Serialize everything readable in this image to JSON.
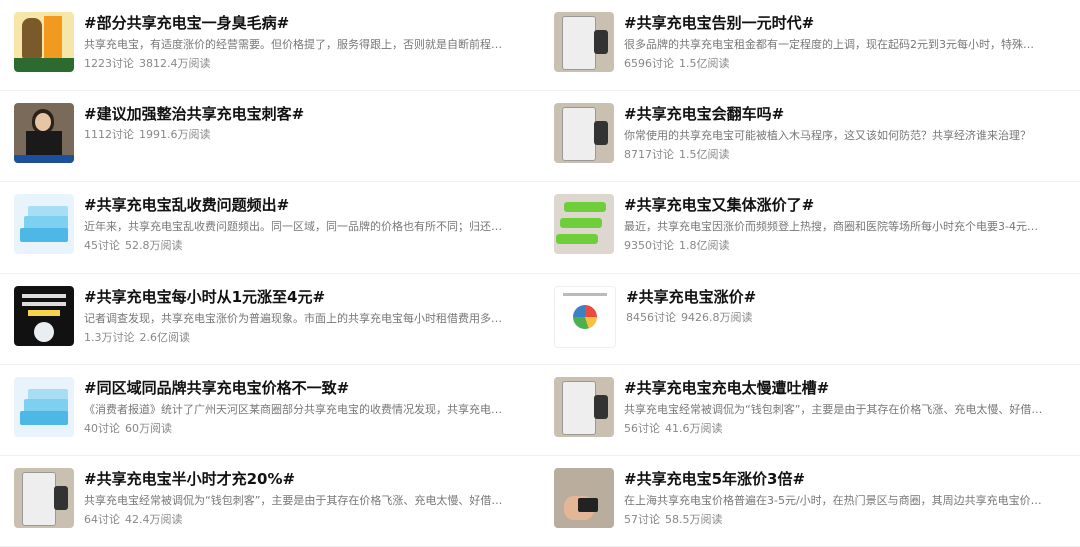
{
  "left": [
    {
      "title": "#部分共享充电宝一身臭毛病#",
      "desc": "共享充电宝，有适度涨价的经营需要。但价格提了，服务得跟上，否则就是自断前程。重视...",
      "discussions": "1223讨论",
      "reads": "3812.4万阅读",
      "thumb": "poster-thumbnail"
    },
    {
      "title": "#建议加强整治共享充电宝刺客#",
      "desc": "",
      "discussions": "1112讨论",
      "reads": "1991.6万阅读",
      "thumb": "news-anchor-thumbnail"
    },
    {
      "title": "#共享充电宝乱收费问题频出#",
      "desc": "近年来，共享充电宝乱收费问题频出。同一区域，同一品牌的价格也有所不同；归还后仍在...",
      "discussions": "45讨论",
      "reads": "52.8万阅读",
      "thumb": "power-bank-blue-thumbnail"
    },
    {
      "title": "#共享充电宝每小时从1元涨至4元#",
      "desc": "记者调查发现，共享充电宝涨价为普遍现象。市面上的共享充电宝每小时租借费用多为3元...",
      "discussions": "1.3万讨论",
      "reads": "2.6亿阅读",
      "thumb": "dark-poster-thumbnail"
    },
    {
      "title": "#同区域同品牌共享充电宝价格不一致#",
      "desc": "《消费者报道》统计了广州天河区某商圈部分共享充电宝的收费情况发现，共享充电宝每小...",
      "discussions": "40讨论",
      "reads": "60万阅读",
      "thumb": "power-bank-blue-thumbnail"
    },
    {
      "title": "#共享充电宝半小时才充20%#",
      "desc": "共享充电宝经常被调侃为“钱包刺客”，主要是由于其存在价格飞涨、充电太慢、好借难还...",
      "discussions": "64讨论",
      "reads": "42.4万阅读",
      "thumb": "charging-station-thumbnail"
    }
  ],
  "right": [
    {
      "title": "#共享充电宝告别一元时代#",
      "desc": "很多品牌的共享充电宝租金都有一定程度的上调，现在起码2元到3元每小时，特殊的高消...",
      "discussions": "6596讨论",
      "reads": "1.5亿阅读",
      "thumb": "charging-station-thumbnail"
    },
    {
      "title": "#共享充电宝会翻车吗#",
      "desc": "你常使用的共享充电宝可能被植入木马程序，这又该如何防范？共享经济谁来治理？",
      "discussions": "8717讨论",
      "reads": "1.5亿阅读",
      "thumb": "charging-station-thumbnail"
    },
    {
      "title": "#共享充电宝又集体涨价了#",
      "desc": "最近，共享充电宝因涨价而频频登上热搜，商圈和医院等场所每小时充个电要3-4元，酒...",
      "discussions": "9350讨论",
      "reads": "1.8亿阅读",
      "thumb": "power-bank-green-thumbnail"
    },
    {
      "title": "#共享充电宝涨价#",
      "desc": "",
      "discussions": "8456讨论",
      "reads": "9426.8万阅读",
      "thumb": "pie-chart-thumbnail"
    },
    {
      "title": "#共享充电宝充电太慢遭吐槽#",
      "desc": "共享充电宝经常被调侃为“钱包刺客”，主要是由于其存在价格飞涨、充电太慢、好借难还...",
      "discussions": "56讨论",
      "reads": "41.6万阅读",
      "thumb": "charging-station-thumbnail"
    },
    {
      "title": "#共享充电宝5年涨价3倍#",
      "desc": "在上海共享充电宝价格普遍在3-5元/小时，在热门景区与商圈，其周边共享充电宝价格...",
      "discussions": "57讨论",
      "reads": "58.5万阅读",
      "thumb": "hand-phone-thumbnail"
    }
  ]
}
